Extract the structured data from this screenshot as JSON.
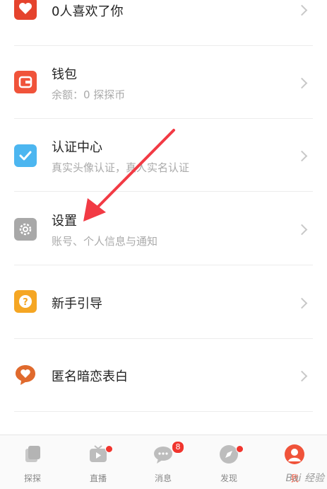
{
  "menu": [
    {
      "id": "likes",
      "title": "0人喜欢了你",
      "subtitle": "",
      "icon": "heart-icon",
      "color": "#e5432d"
    },
    {
      "id": "wallet",
      "title": "钱包",
      "subtitle": "余额：0 探探币",
      "icon": "wallet-icon",
      "color": "#f0533a"
    },
    {
      "id": "verify",
      "title": "认证中心",
      "subtitle": "真实头像认证，真人实名认证",
      "icon": "checkmark-icon",
      "color": "#4cb6f0"
    },
    {
      "id": "settings",
      "title": "设置",
      "subtitle": "账号、个人信息与通知",
      "icon": "gear-icon",
      "color": "#a8a8a8"
    },
    {
      "id": "guide",
      "title": "新手引导",
      "subtitle": "",
      "icon": "question-icon",
      "color": "#f5a623"
    },
    {
      "id": "confess",
      "title": "匿名暗恋表白",
      "subtitle": "",
      "icon": "heart-bubble-icon",
      "color": "#e06a2d"
    }
  ],
  "tabbar": {
    "tabs": [
      {
        "label": "探探",
        "icon": "cards-icon"
      },
      {
        "label": "直播",
        "icon": "tv-play-icon"
      },
      {
        "label": "消息",
        "icon": "chat-icon",
        "badge": "8"
      },
      {
        "label": "发现",
        "icon": "compass-icon"
      },
      {
        "label": "我",
        "icon": "profile-icon"
      }
    ],
    "active_color": "#f0533a"
  },
  "watermark": "Bai 经验"
}
